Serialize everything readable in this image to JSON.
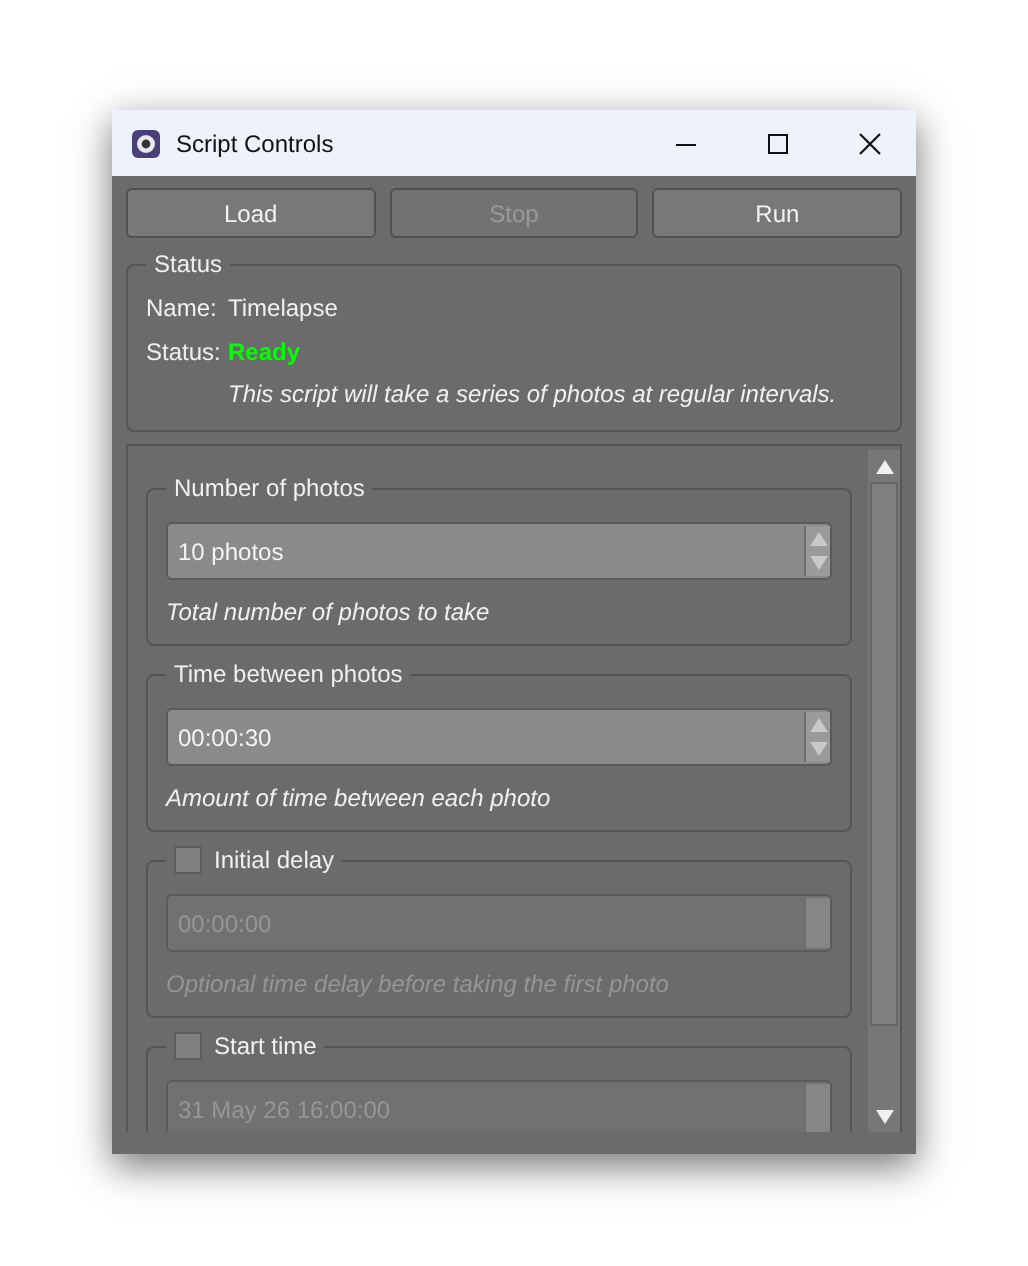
{
  "window": {
    "title": "Script Controls"
  },
  "buttons": [
    {
      "label": "Load",
      "disabled": false
    },
    {
      "label": "Stop",
      "disabled": true
    },
    {
      "label": "Run",
      "disabled": false
    }
  ],
  "status": {
    "title": "Status",
    "name_label": "Name:",
    "name": "Timelapse",
    "status_label": "Status:",
    "status": "Ready",
    "description": "This script will take a series of photos at regular intervals."
  },
  "settings": [
    {
      "kind": "plain",
      "title": "Number of photos",
      "value": "10 photos",
      "hint": "Total number of photos to take",
      "disabled": false
    },
    {
      "kind": "plain",
      "title": "Time between photos",
      "value": "00:00:30",
      "hint": "Amount of time between each photo",
      "disabled": false
    },
    {
      "kind": "optional",
      "title": "Initial delay",
      "checked": false,
      "value": "00:00:00",
      "hint": "Optional time delay before taking the first photo",
      "disabled": true
    },
    {
      "kind": "optional",
      "title": "Start time",
      "checked": false,
      "value": "31 May 26 16:00:00",
      "disabled": true
    }
  ]
}
